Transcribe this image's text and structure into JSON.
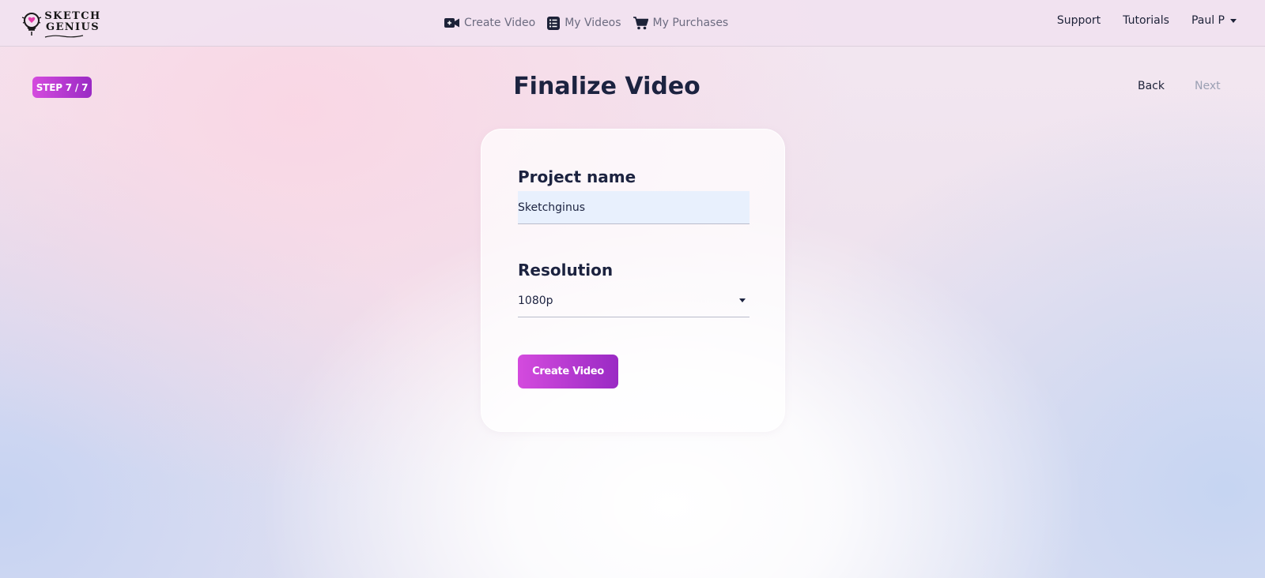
{
  "header": {
    "logo": {
      "line1": "SKETCH",
      "line2": "GENIUS"
    },
    "nav": [
      {
        "label": "Create Video",
        "icon": "video-camera-icon"
      },
      {
        "label": "My Videos",
        "icon": "list-icon"
      },
      {
        "label": "My Purchases",
        "icon": "cart-icon"
      }
    ],
    "right": {
      "support": "Support",
      "tutorials": "Tutorials",
      "user": "Paul P"
    }
  },
  "step": {
    "badge": "STEP 7 / 7",
    "title": "Finalize Video",
    "back": "Back",
    "next": "Next"
  },
  "form": {
    "project_label": "Project name",
    "project_value": "Sketchginus",
    "resolution_label": "Resolution",
    "resolution_value": "1080p",
    "submit": "Create Video"
  },
  "colors": {
    "accent_start": "#d44bde",
    "accent_end": "#9a2ac4",
    "text_dark": "#1c2340",
    "text_muted": "#6c6b80",
    "disabled": "#9ba0b3",
    "input_bg": "#e8f0fd"
  }
}
